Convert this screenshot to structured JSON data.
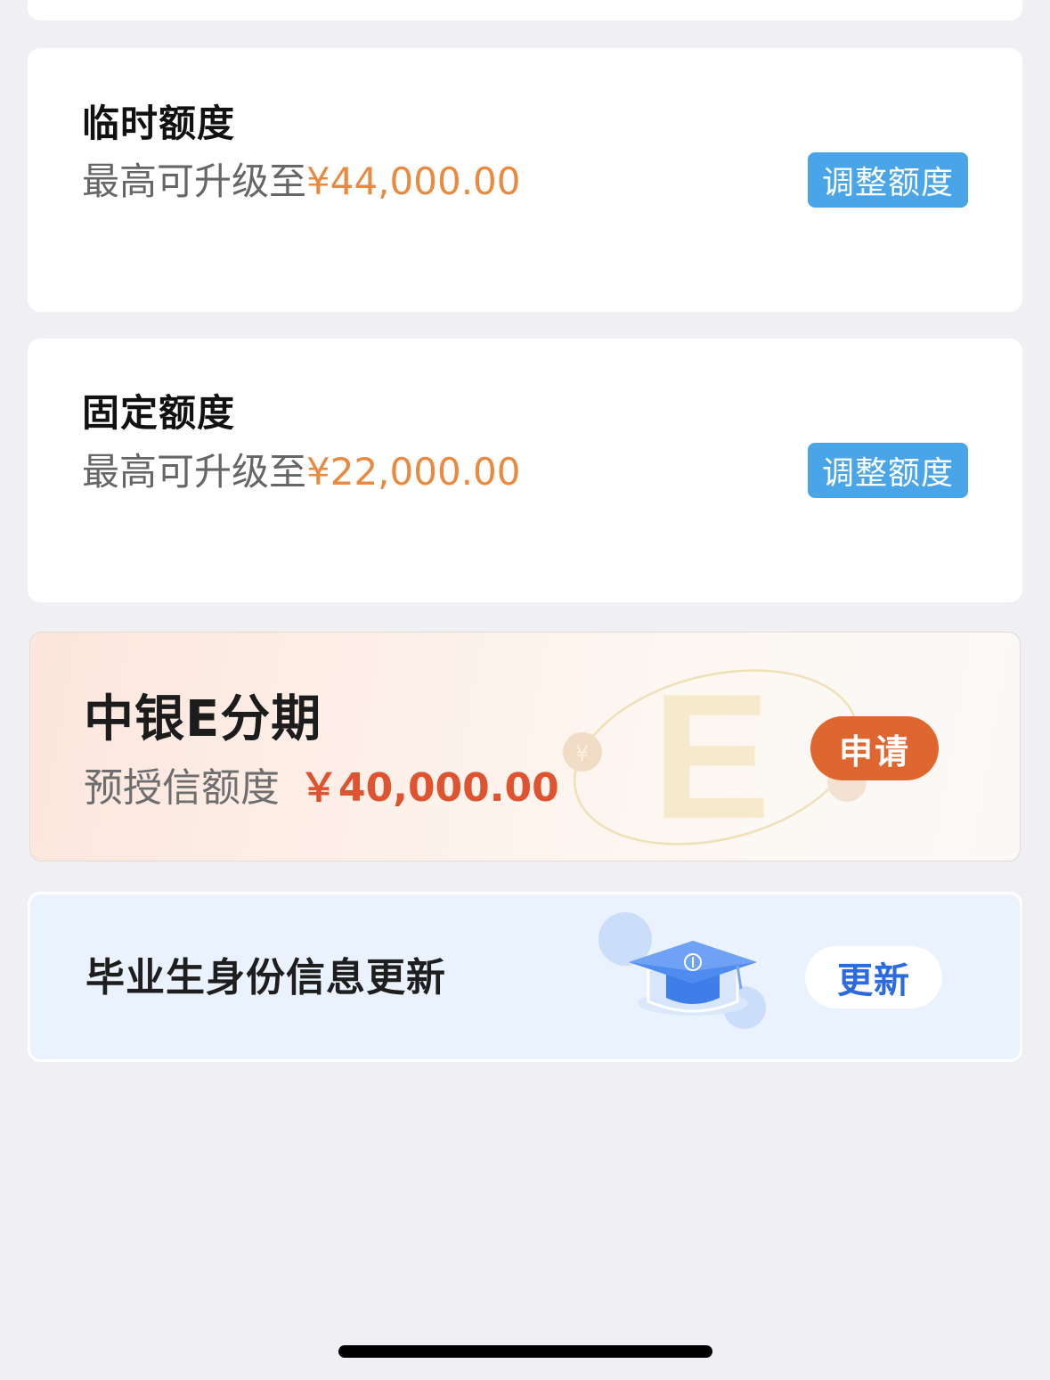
{
  "limits": [
    {
      "title": "临时额度",
      "desc_prefix": "最高可升级至",
      "amount": "¥44,000.00",
      "button_label": "调整额度"
    },
    {
      "title": "固定额度",
      "desc_prefix": "最高可升级至",
      "amount": "¥22,000.00",
      "button_label": "调整额度"
    }
  ],
  "e_installment": {
    "title": "中银E分期",
    "desc_prefix": "预授信额度",
    "amount": "￥40,000.00",
    "button_label": "申请"
  },
  "graduate": {
    "title": "毕业生身份信息更新",
    "button_label": "更新"
  },
  "colors": {
    "background": "#efeff4",
    "amount_orange": "#ea8a41",
    "adjust_button": "#4aa4e8",
    "apply_button": "#e0662f",
    "e_amount": "#de5431",
    "update_text": "#2c6ae0"
  }
}
